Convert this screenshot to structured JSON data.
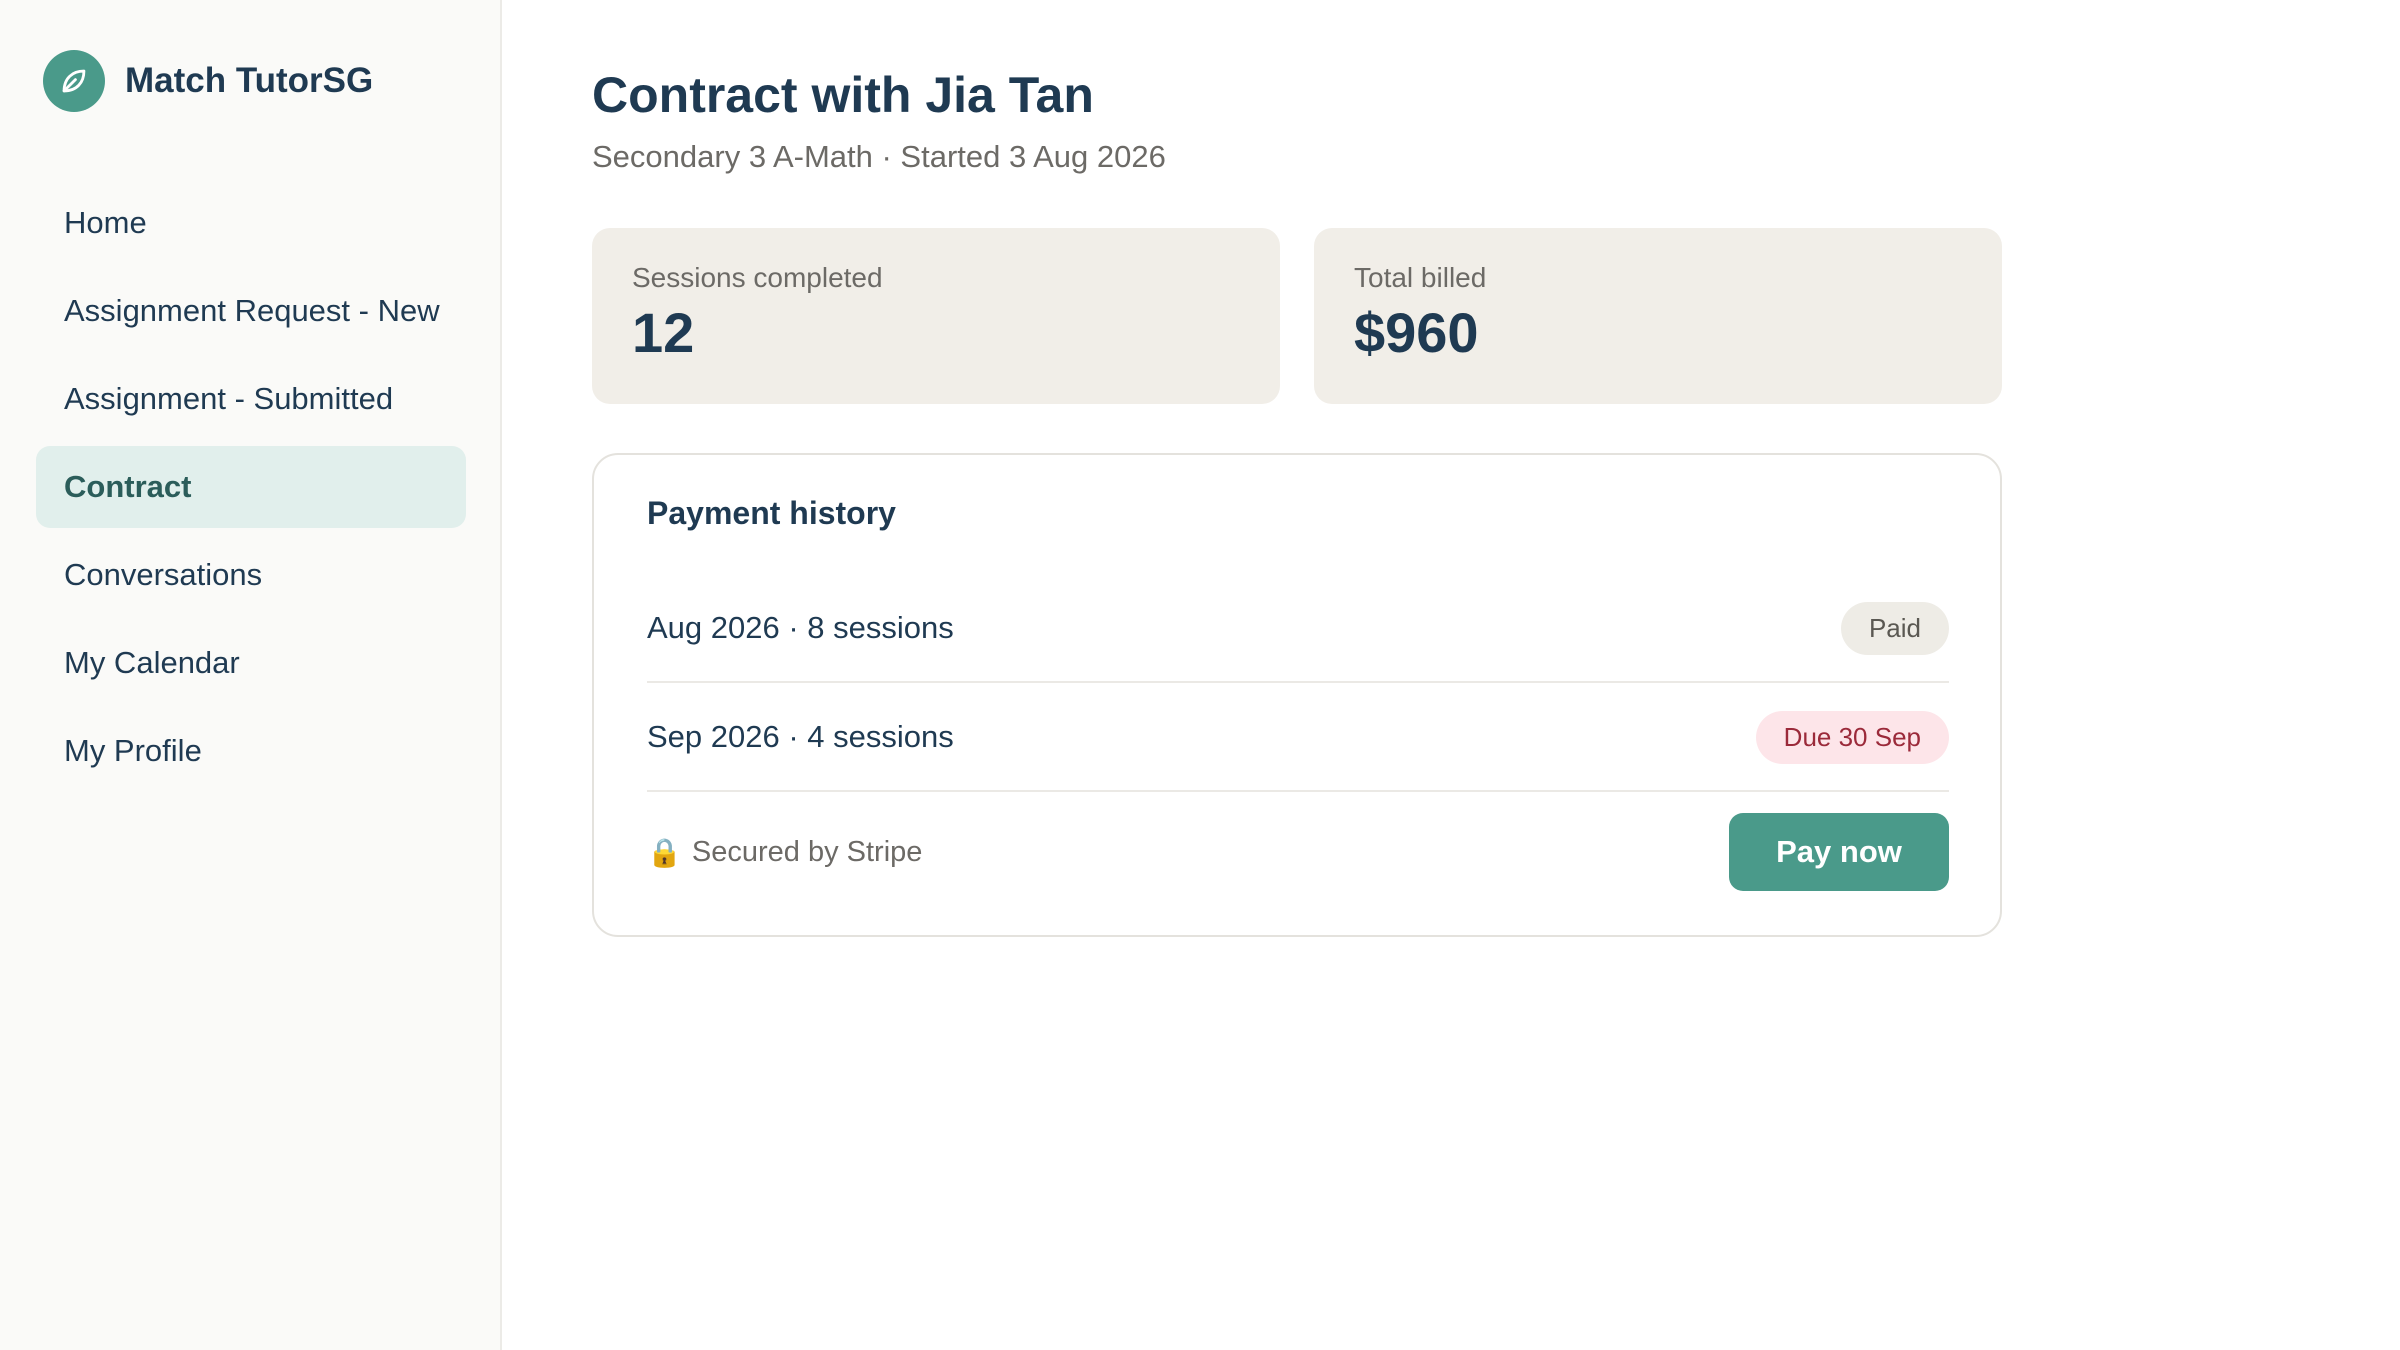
{
  "brand": {
    "name": "Match TutorSG",
    "logo_icon": "leaf-icon",
    "color": "#4a9a8a"
  },
  "nav": {
    "items": [
      {
        "label": "Home",
        "active": false
      },
      {
        "label": "Assignment Request - New",
        "active": false
      },
      {
        "label": "Assignment - Submitted",
        "active": false
      },
      {
        "label": "Contract",
        "active": true
      },
      {
        "label": "Conversations",
        "active": false
      },
      {
        "label": "My Calendar",
        "active": false
      },
      {
        "label": "My Profile",
        "active": false
      }
    ]
  },
  "page": {
    "title": "Contract with Jia Tan",
    "subtitle": "Secondary 3 A-Math · Started 3 Aug 2026"
  },
  "stats": {
    "sessions": {
      "label": "Sessions completed",
      "value": "12"
    },
    "billed": {
      "label": "Total billed",
      "value": "$960"
    }
  },
  "payments": {
    "title": "Payment history",
    "rows": [
      {
        "label": "Aug 2026 · 8 sessions",
        "status": "Paid",
        "status_color": "#5a5852"
      },
      {
        "label": "Sep 2026 · 4 sessions",
        "status": "Due 30 Sep",
        "status_color": "#9b2a3a"
      }
    ],
    "secured_icon": "lock-icon",
    "secured_text": "Secured by Stripe",
    "pay_label": "Pay now"
  }
}
